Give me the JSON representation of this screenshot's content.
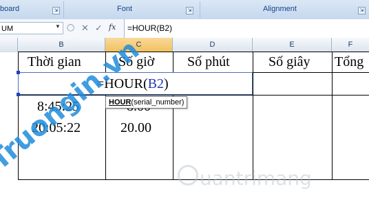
{
  "ribbon": {
    "groups": [
      {
        "label": "board"
      },
      {
        "label": "Font"
      },
      {
        "label": "Alignment"
      }
    ]
  },
  "formula_bar": {
    "name_box": "UM",
    "fx_label": "fx",
    "formula": "=HOUR(B2)"
  },
  "columns": [
    "B",
    "C",
    "D",
    "E",
    "F"
  ],
  "selected_column": "C",
  "sheet": {
    "headers": [
      "Thời gian",
      "Số giờ",
      "Số phút",
      "Số giây",
      "Tổng"
    ],
    "edit_formula_prefix": "=HOUR(",
    "edit_formula_ref": "B2",
    "edit_formula_suffix": ")",
    "rows": [
      {
        "time": "8:45:25",
        "hours": "8.00"
      },
      {
        "time": "20:05:22",
        "hours": "20.00"
      }
    ]
  },
  "tooltip": {
    "func": "HOUR",
    "args": "(serial_number)"
  },
  "watermarks": {
    "left": "Truongin.vn",
    "right": "uantrimang"
  },
  "colors": {
    "ref": "#1d3ab5",
    "accent": "#4a6fb5",
    "selected_header": "#f1c15f"
  }
}
